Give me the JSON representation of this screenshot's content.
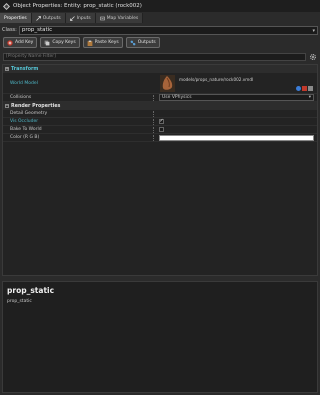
{
  "window": {
    "title": "Object Properties: Entity: prop_static (rock002)"
  },
  "tabs": [
    {
      "label": "Properties",
      "active": true
    },
    {
      "label": "Outputs",
      "active": false
    },
    {
      "label": "Inputs",
      "active": false
    },
    {
      "label": "Map Variables",
      "active": false
    }
  ],
  "class": {
    "label": "Class:",
    "value": "prop_static"
  },
  "toolbar": {
    "add_key": "Add Key",
    "copy_keys": "Copy Keys",
    "paste_keys": "Paste Keys",
    "outputs": "Outputs"
  },
  "filter": {
    "placeholder": "[Property Name Filter]"
  },
  "grid": {
    "transform": {
      "title": "Transform"
    },
    "world_model": {
      "label": "World Model",
      "value": "models/props_nature/rock002.vmdl"
    },
    "collisions": {
      "label": "Collisions",
      "value": "Use VPhysics"
    },
    "render": {
      "title": "Render Properties"
    },
    "detail_geometry": {
      "label": "Detail Geometry"
    },
    "vis_occluder": {
      "label": "Vis Occluder",
      "checked": true
    },
    "bake_to_world": {
      "label": "Bake To World",
      "checked": false
    },
    "color": {
      "label": "Color (R G B)",
      "value": "#ffffff"
    }
  },
  "help": {
    "title": "prop_static",
    "body": "prop_static"
  },
  "colors": {
    "accent_teal": "#4fb8c8",
    "background": "#2b2b2b"
  }
}
